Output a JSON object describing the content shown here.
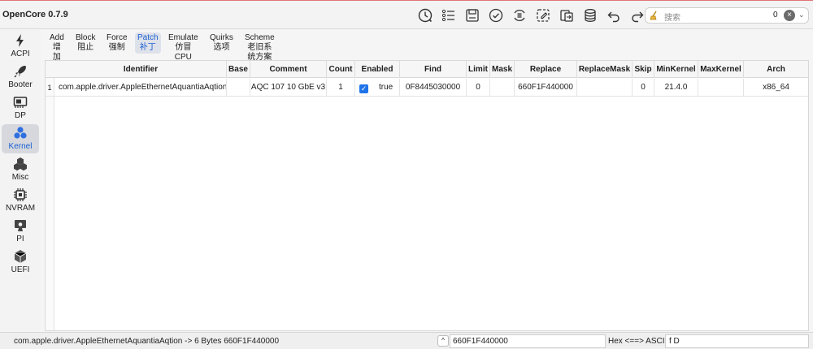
{
  "app": {
    "title": "OpenCore 0.7.9"
  },
  "toolbar": {
    "icons": [
      "history-clock-icon",
      "list-icon",
      "save-icon",
      "check-circle-icon",
      "refresh-list-icon",
      "screenshot-edit-icon",
      "import-export-icon",
      "database-icon",
      "undo-icon",
      "redo-icon"
    ]
  },
  "search": {
    "placeholder": "搜索",
    "count": "0"
  },
  "sidebar": {
    "items": [
      {
        "label": "ACPI",
        "icon": "acpi-icon"
      },
      {
        "label": "Booter",
        "icon": "rocket-icon"
      },
      {
        "label": "DP",
        "icon": "device-card-icon"
      },
      {
        "label": "Kernel",
        "icon": "kernel-icon",
        "active": true
      },
      {
        "label": "Misc",
        "icon": "misc-icon"
      },
      {
        "label": "NVRAM",
        "icon": "chip-icon"
      },
      {
        "label": "PI",
        "icon": "monitor-apple-icon"
      },
      {
        "label": "UEFI",
        "icon": "cube-icon"
      }
    ]
  },
  "subtabs": [
    {
      "en": "Add",
      "zh": "增加"
    },
    {
      "en": "Block",
      "zh": "阻止"
    },
    {
      "en": "Force",
      "zh": "强制"
    },
    {
      "en": "Patch",
      "zh": "补丁",
      "active": true
    },
    {
      "en": "Emulate",
      "zh": "仿冒CPU"
    },
    {
      "en": "Quirks",
      "zh": "选项"
    },
    {
      "en": "Scheme",
      "zh": "老旧系统方案"
    }
  ],
  "table": {
    "headers": [
      "Identifier",
      "Base",
      "Comment",
      "Count",
      "Enabled",
      "Find",
      "Limit",
      "Mask",
      "Replace",
      "ReplaceMask",
      "Skip",
      "MinKernel",
      "MaxKernel",
      "Arch"
    ],
    "rows": [
      {
        "num": "1",
        "identifier": "com.apple.driver.AppleEthernetAquantiaAqtion",
        "base": "",
        "comment": "AQC 107 10 GbE v3",
        "count": "1",
        "enabled": "true",
        "find": "0F8445030000",
        "limit": "0",
        "mask": "",
        "replace": "660F1F440000",
        "replacemask": "",
        "skip": "0",
        "minkernel": "21.4.0",
        "maxkernel": "",
        "arch": "x86_64"
      }
    ]
  },
  "statusbar": {
    "text": "com.apple.driver.AppleEthernetAquantiaAqtion -> 6 Bytes  660F1F440000",
    "hex_value": "660F1F440000",
    "conversion_label": "Hex <==> ASCII",
    "ascii_value": "f D"
  }
}
